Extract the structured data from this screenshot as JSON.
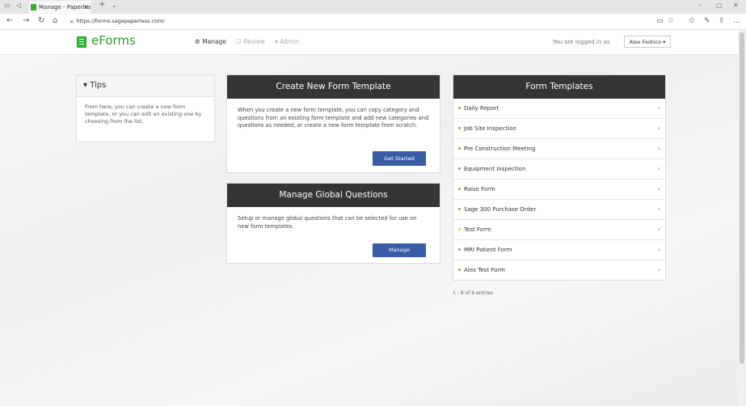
{
  "browser": {
    "tab_title": "Manage - Paperless For",
    "tab_close": "×",
    "new_tab": "+",
    "tab_menu": "⌄",
    "url": "https://forms.sagepaperless.com/",
    "window_controls": [
      "–",
      "▢",
      "✕"
    ],
    "nav": [
      "←",
      "→",
      "↻",
      "⌂"
    ],
    "right_icons": [
      "▭",
      "☆",
      "✩",
      "✎",
      "⇪",
      "…"
    ]
  },
  "header": {
    "brand": "eForms",
    "menu": [
      {
        "icon": "⚙",
        "label": "Manage",
        "active": true
      },
      {
        "icon": "☑",
        "label": "Review",
        "active": false
      },
      {
        "icon": "▾",
        "label": "Admin",
        "active": false
      }
    ],
    "login_text": "You are logged in as",
    "user": "Alex Fedrico ▾"
  },
  "tips": {
    "title": "▾ Tips",
    "body": "From here, you can create a new form template, or you can edit an existing one by choosing from the list."
  },
  "create": {
    "title": "Create New Form Template",
    "body": "When you create a new form template, you can copy category and questions from an existing form template and add new categories and questions as needed, or create a new form template from scratch.",
    "button": "Get Started"
  },
  "global": {
    "title": "Manage Global Questions",
    "body": "Setup or manage global questions that can be selected for use on new form templates.",
    "button": "Manage"
  },
  "templates": {
    "title": "Form Templates",
    "items": [
      {
        "label": "Daily Report",
        "color": "#7cb342"
      },
      {
        "label": "Job Site Inspection",
        "color": "#7cb342"
      },
      {
        "label": "Pre Construction Meeting",
        "color": "#7cb342"
      },
      {
        "label": "Equipment Inspection",
        "color": "#7cb342"
      },
      {
        "label": "Raise Form",
        "color": "#7cb342"
      },
      {
        "label": "Sage 300 Purchase Order",
        "color": "#7cb342"
      },
      {
        "label": "Test Form",
        "color": "#fbc02d"
      },
      {
        "label": "MRI Patient Form",
        "color": "#7cb342"
      },
      {
        "label": "Alex Test Form",
        "color": "#7cb342"
      }
    ],
    "chevron": "›",
    "entries": "1 - 9 of 9 entries"
  }
}
